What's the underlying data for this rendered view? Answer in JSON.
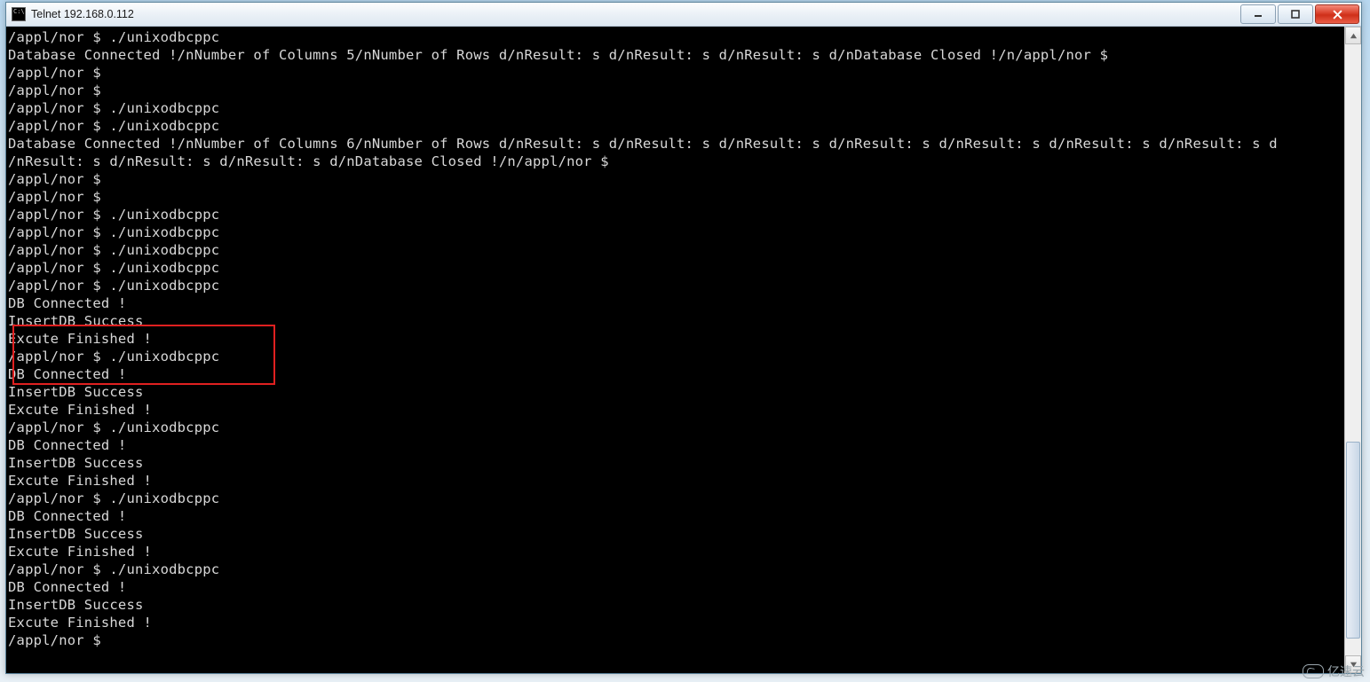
{
  "window": {
    "title": "Telnet 192.168.0.112"
  },
  "highlight": {
    "start": 16,
    "end": 18
  },
  "terminal": {
    "lines": [
      "/appl/nor $ ./unixodbcppc",
      "Database Connected !/nNumber of Columns 5/nNumber of Rows d/nResult: s d/nResult: s d/nResult: s d/nDatabase Closed !/n/appl/nor $",
      "/appl/nor $",
      "/appl/nor $",
      "/appl/nor $ ./unixodbcppc",
      "/appl/nor $ ./unixodbcppc",
      "Database Connected !/nNumber of Columns 6/nNumber of Rows d/nResult: s d/nResult: s d/nResult: s d/nResult: s d/nResult: s d/nResult: s d/nResult: s d",
      "/nResult: s d/nResult: s d/nResult: s d/nDatabase Closed !/n/appl/nor $",
      "/appl/nor $",
      "/appl/nor $",
      "/appl/nor $ ./unixodbcppc",
      "/appl/nor $ ./unixodbcppc",
      "/appl/nor $ ./unixodbcppc",
      "/appl/nor $ ./unixodbcppc",
      "/appl/nor $ ./unixodbcppc",
      "DB Connected !",
      "InsertDB Success",
      "Excute Finished !",
      "/appl/nor $ ./unixodbcppc",
      "DB Connected !",
      "InsertDB Success",
      "Excute Finished !",
      "/appl/nor $ ./unixodbcppc",
      "DB Connected !",
      "InsertDB Success",
      "Excute Finished !",
      "/appl/nor $ ./unixodbcppc",
      "DB Connected !",
      "InsertDB Success",
      "Excute Finished !",
      "/appl/nor $ ./unixodbcppc",
      "DB Connected !",
      "InsertDB Success",
      "Excute Finished !",
      "/appl/nor $"
    ]
  },
  "watermark": {
    "text": "亿速云"
  }
}
